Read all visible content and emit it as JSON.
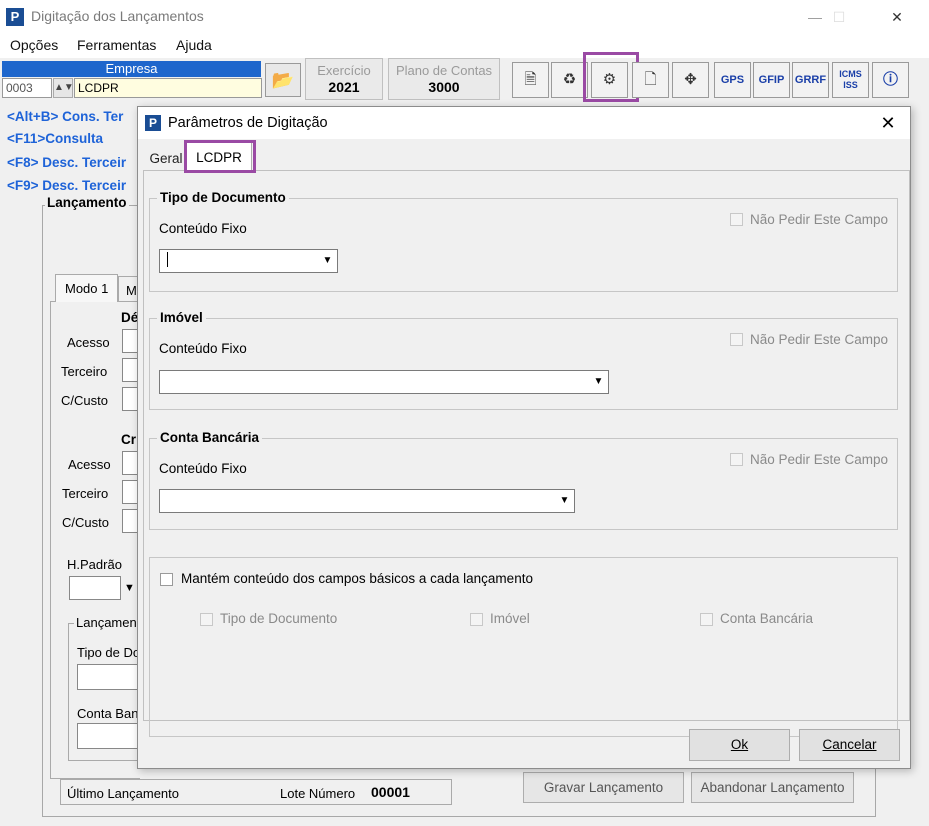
{
  "window": {
    "title": "Digitação dos Lançamentos",
    "app_icon_letter": "P",
    "minimize": "—",
    "maximize": "☐",
    "close": "✕"
  },
  "menu": [
    "Opções",
    "Ferramentas",
    "Ajuda"
  ],
  "toolbar": {
    "empresa_label": "Empresa",
    "empresa_code": "0003",
    "empresa_name": "LCDPR",
    "exercicio_label": "Exercício",
    "exercicio_value": "2021",
    "plano_label": "Plano de Contas",
    "plano_value": "3000",
    "buttons": [
      "GPS",
      "GFIP",
      "GRRF",
      "ICMS",
      "ISS"
    ]
  },
  "shortcuts": [
    "<Alt+B> Cons. Ter",
    "<F11>Consulta",
    "<F8> Desc. Terceir",
    "<F9> Desc. Terceir"
  ],
  "background_form": {
    "lancamento_title": "Lançamento",
    "tab_modo": "Modo 1",
    "tab_m": "M",
    "debito_title": "Dé",
    "credito_title": "Cr",
    "labels_debito": [
      "Acesso",
      "Terceiro",
      "C/Custo"
    ],
    "labels_credito": [
      "Acesso",
      "Terceiro",
      "C/Custo"
    ],
    "hpadrao": "H.Padrão",
    "lanc_box_title": "Lançamen",
    "tipo_doc_label": "Tipo de Do",
    "conta_ban_label": "Conta Ban",
    "ultimo_lancamento": "Último Lançamento",
    "lote_label": "Lote Número",
    "lote_value": "00001",
    "gravar_button": "Gravar Lançamento",
    "abandonar_button": "Abandonar Lançamento"
  },
  "dialog": {
    "title": "Parâmetros de Digitação",
    "close": "✕",
    "tabs": [
      "Geral",
      "LCDPR"
    ],
    "groups": [
      {
        "title": "Tipo de Documento",
        "fixo_label": "Conteúdo Fixo",
        "nao_pedir": "Não Pedir Este Campo",
        "value": ""
      },
      {
        "title": "Imóvel",
        "fixo_label": "Conteúdo Fixo",
        "nao_pedir": "Não Pedir Este Campo",
        "value": ""
      },
      {
        "title": "Conta Bancária",
        "fixo_label": "Conteúdo Fixo",
        "nao_pedir": "Não Pedir Este Campo",
        "value": ""
      }
    ],
    "mantem": {
      "label": "Mantém conteúdo dos campos básicos a cada lançamento",
      "options": [
        "Tipo de Documento",
        "Imóvel",
        "Conta Bancária"
      ]
    },
    "ok_button": "Ok",
    "cancel_button": "Cancelar"
  },
  "colors": {
    "highlight": "#9a4aa4",
    "shortcut_blue": "#1e63d8",
    "empresa_bar": "#1e66cc"
  }
}
